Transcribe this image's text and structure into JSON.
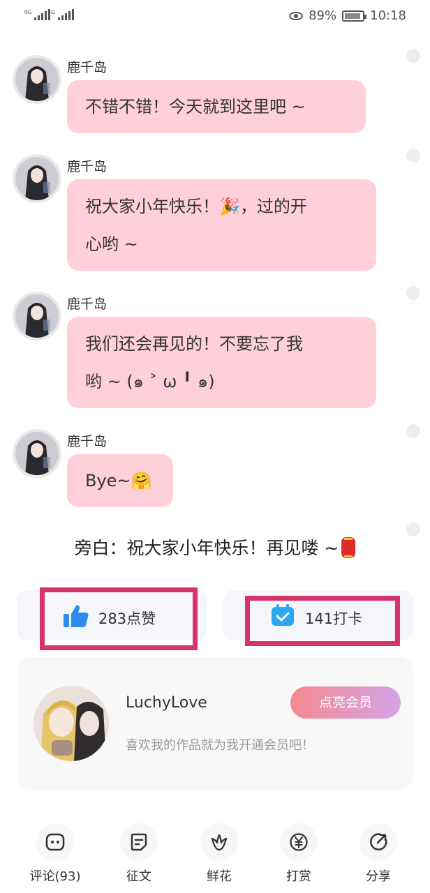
{
  "status_bar": {
    "signal_1": "4G",
    "signal_2": "4G",
    "battery": "89%",
    "time": "10:18"
  },
  "messages": [
    {
      "sender": "鹿千岛",
      "lines": [
        "不错不错！今天就到这里吧 ~"
      ]
    },
    {
      "sender": "鹿千岛",
      "lines": [
        "祝大家小年快乐！🎉，过的开",
        "心哟 ~"
      ]
    },
    {
      "sender": "鹿千岛",
      "lines": [
        "我们还会再见的！不要忘了我",
        "哟 ~ (๑ ˃ ω ╹ ๑)"
      ]
    },
    {
      "sender": "鹿千岛",
      "lines": [
        "Bye~🤗"
      ]
    }
  ],
  "narration": "旁白：祝大家小年快乐！再见喽 ~",
  "stats": {
    "likes": "283点赞",
    "checkins": "141打卡"
  },
  "member_card": {
    "username": "LuchyLove",
    "slogan": "喜欢我的作品就为我开通会员吧！",
    "button": "点亮会员"
  },
  "bottom_bar": [
    {
      "label": "评论(93)",
      "icon": "comment-icon"
    },
    {
      "label": "征文",
      "icon": "essay-icon"
    },
    {
      "label": "鲜花",
      "icon": "flower-icon"
    },
    {
      "label": "打赏",
      "icon": "reward-icon"
    },
    {
      "label": "分享",
      "icon": "share-icon"
    }
  ],
  "colors": {
    "bubble": "#ffd0da",
    "highlight": "#d6336c",
    "like_icon": "#2d8cf0",
    "vip_gradient_start": "#f58a8f",
    "vip_gradient_end": "#d4a3e8"
  }
}
